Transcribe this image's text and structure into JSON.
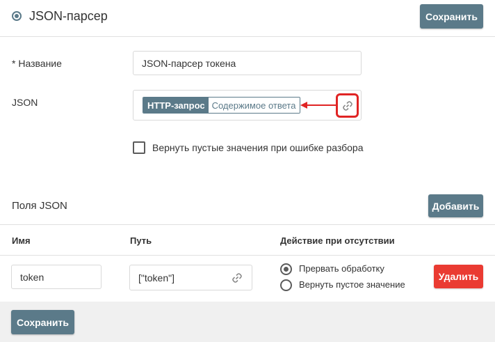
{
  "header": {
    "title": "JSON-парсер",
    "save_label": "Сохранить"
  },
  "form": {
    "name_label": "* Название",
    "name_value": "JSON-парсер токена",
    "json_label": "JSON",
    "json_tag_source": "HTTP-запрос",
    "json_tag_field": "Содержимое ответа",
    "checkbox_label": "Вернуть пустые значения при ошибке разбора",
    "checkbox_checked": false
  },
  "fields_section": {
    "title": "Поля JSON",
    "add_label": "Добавить",
    "columns": [
      "Имя",
      "Путь",
      "Действие при отсутствии"
    ],
    "rows": [
      {
        "name": "token",
        "path": "[\"token\"]",
        "options": [
          "Прервать обработку",
          "Вернуть пустое значение"
        ],
        "selected": "Прервать обработку",
        "delete_label": "Удалить"
      }
    ]
  },
  "footer": {
    "save_label": "Сохранить"
  },
  "colors": {
    "primary_button": "#5b7a89",
    "delete_button": "#ea3b32",
    "highlight": "#e02424"
  },
  "icons": [
    "radio-dot-icon",
    "link-icon",
    "arrow-left-icon"
  ]
}
